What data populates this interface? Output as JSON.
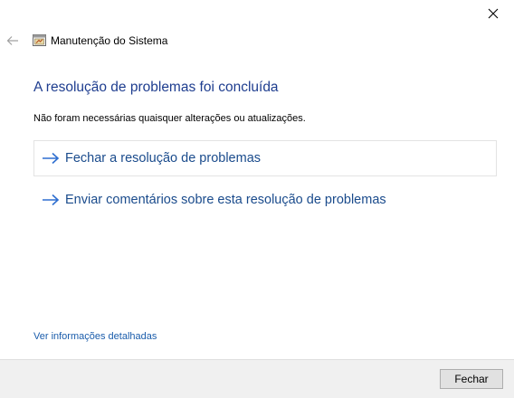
{
  "window": {
    "title": "Manutenção do Sistema",
    "icons": {
      "close": "close-icon",
      "back": "back-arrow-icon",
      "app": "system-maintenance-icon"
    }
  },
  "content": {
    "heading": "A resolução de problemas foi concluída",
    "description": "Não foram necessárias quaisquer alterações ou atualizações.",
    "commands": [
      {
        "label": "Fechar a resolução de problemas",
        "icon": "arrow-right-icon"
      },
      {
        "label": "Enviar comentários sobre esta resolução de problemas",
        "icon": "arrow-right-icon"
      }
    ],
    "details_link": "Ver informações detalhadas"
  },
  "footer": {
    "close_button": "Fechar"
  },
  "colors": {
    "heading": "#1e3d8f",
    "link": "#1a4b8c",
    "arrow": "#2f6fd0",
    "footer_bg": "#f0f0f0"
  }
}
